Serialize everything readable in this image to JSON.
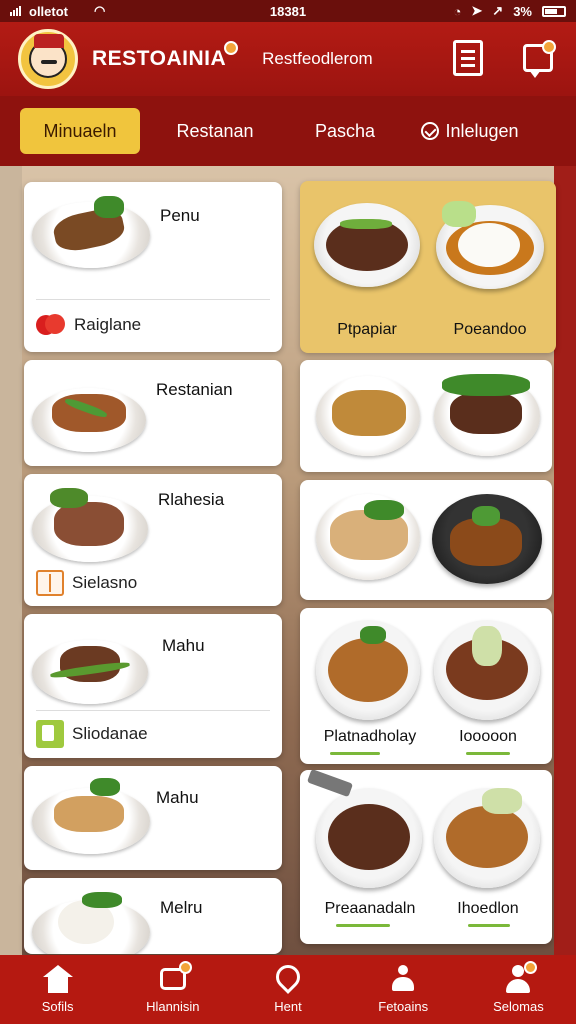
{
  "status_bar": {
    "carrier": "olletot",
    "time": "18381",
    "battery": "3%"
  },
  "header": {
    "brand": "RESTOAINIA",
    "subtitle": "Restfeodlerom"
  },
  "tabs": [
    {
      "label": "Minuaeln",
      "active": true
    },
    {
      "label": "Restanan",
      "active": false
    },
    {
      "label": "Pascha",
      "active": false
    },
    {
      "label": "Inlelugen",
      "active": false
    }
  ],
  "left_cards": [
    {
      "title": "Penu",
      "sub_label": "Raiglane",
      "sub_icon": "tomato-icon"
    },
    {
      "title": "Restanian"
    },
    {
      "title": "Rlahesia",
      "sub_label": "Sielasno",
      "sub_icon": "book-icon"
    },
    {
      "title": "Mahu",
      "sub_label": "Sliodanae",
      "sub_icon": "cup-icon"
    },
    {
      "title": "Mahu"
    },
    {
      "title": "Melru"
    }
  ],
  "right_cards": [
    {
      "captions": [
        "Ptpapiar",
        "Poeandoo"
      ],
      "highlighted": true
    },
    {
      "captions": []
    },
    {
      "captions": []
    },
    {
      "captions": [
        "Platnadholay",
        "Iooooon"
      ]
    },
    {
      "captions": [
        "Preaanadaln",
        "Ihoedlon"
      ]
    }
  ],
  "bottom_nav": [
    {
      "label": "Sofils",
      "icon": "home-icon"
    },
    {
      "label": "Hlannisin",
      "icon": "chat-icon"
    },
    {
      "label": "Hent",
      "icon": "location-pin-icon"
    },
    {
      "label": "Fetoains",
      "icon": "people-icon"
    },
    {
      "label": "Selomas",
      "icon": "profile-icon"
    }
  ],
  "colors": {
    "primary": "#b31b14",
    "accent": "#f0c53d",
    "highlight_card": "#e9c46a"
  }
}
